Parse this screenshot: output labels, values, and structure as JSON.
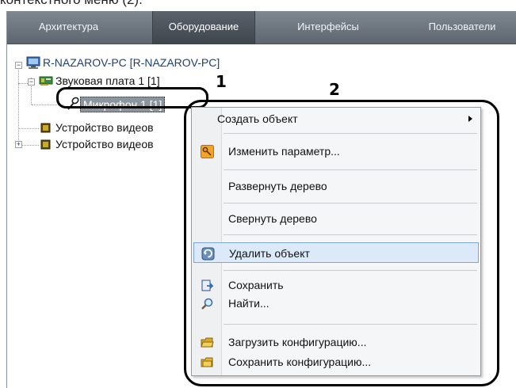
{
  "caption": "контекстного меню (2).",
  "tabs": [
    {
      "label": "Архитектура",
      "active": false
    },
    {
      "label": "Оборудование",
      "active": true
    },
    {
      "label": "Интерфейсы",
      "active": false
    },
    {
      "label": "Пользователи",
      "active": false
    }
  ],
  "tree": {
    "root": {
      "label": "R-NAZAROV-PC [R-NAZAROV-PC]",
      "icon": "computer-icon"
    },
    "sound_card": {
      "label": "Звуковая плата 1 [1]",
      "icon": "sound-card-icon"
    },
    "microphone": {
      "label": "Микрофон 1 [1]",
      "icon": "microphone-icon",
      "selected": true
    },
    "video_device_1": {
      "label": "Устройство видеов",
      "icon": "chip-icon"
    },
    "video_device_2": {
      "label": "Устройство видеов",
      "icon": "chip-icon"
    }
  },
  "callouts": {
    "one": "1",
    "two": "2"
  },
  "context_menu": {
    "create": {
      "label": "Создать объект",
      "has_submenu": true
    },
    "edit": {
      "label": "Изменить параметр...",
      "icon": "key-icon"
    },
    "expand": {
      "label": "Развернуть дерево"
    },
    "collapse": {
      "label": "Свернуть дерево"
    },
    "delete": {
      "label": "Удалить объект",
      "icon": "delete-icon",
      "highlighted": true
    },
    "save": {
      "label": "Сохранить",
      "icon": "save-icon"
    },
    "find": {
      "label": "Найти...",
      "icon": "magnifier-icon"
    },
    "load_config": {
      "label": "Загрузить конфигурацию...",
      "icon": "folder-load-icon"
    },
    "save_config": {
      "label": "Сохранить конфигурацию...",
      "icon": "folder-save-icon"
    }
  },
  "colors": {
    "tabbar": "#6f7781",
    "tab_active": "#4a5059",
    "selection": "#8c949d",
    "menu_highlight": "#dbe9f9",
    "callout_ring": "#000000"
  }
}
